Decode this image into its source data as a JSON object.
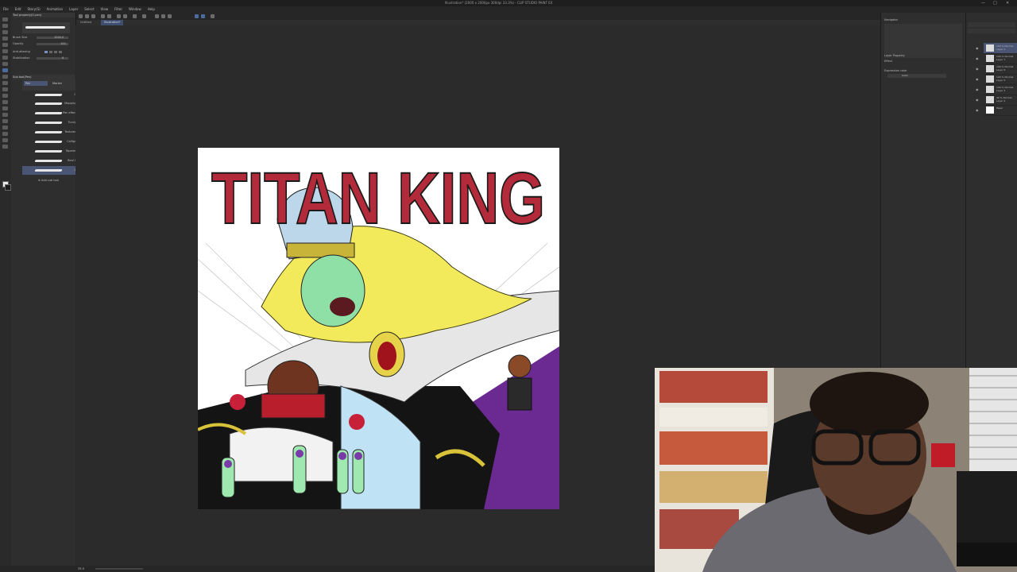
{
  "window": {
    "title": "Illustration* (2000 x 2000px 300dpi 33.3%) - CLIP STUDIO PAINT EX",
    "minimize": "—",
    "maximize": "□",
    "close": "✕"
  },
  "menu": [
    "File",
    "Edit",
    "Story(S)",
    "Animation",
    "Layer",
    "Select",
    "View",
    "Filter",
    "Window",
    "Help"
  ],
  "tabs": [
    "Untitled",
    "Illustration*"
  ],
  "sub_tool": {
    "header": "Tool property(G-pen)",
    "brush_size_label": "Brush Size",
    "brush_size_value": "1000.0",
    "opacity_label": "Opacity",
    "opacity_value": "100",
    "antialias_label": "Anti-aliasing",
    "stabilization_label": "Stabilization",
    "stabilization_value": "6",
    "group_tabs": [
      "Pen",
      "Marker"
    ],
    "group_header": "Sub tool(Pen)",
    "add_tool_label": "Add sub tool"
  },
  "brushes": [
    {
      "name": "G-pen"
    },
    {
      "name": "Mapping pen"
    },
    {
      "name": "Pen effect line"
    },
    {
      "name": "Turnip pen"
    },
    {
      "name": "Textured pen"
    },
    {
      "name": "Calligraphy"
    },
    {
      "name": "Tapered Pen"
    },
    {
      "name": "Real G Pen"
    },
    {
      "name": "G pen"
    }
  ],
  "right_panel": {
    "navigator_header": "Navigator",
    "layer_property_header": "Layer Property",
    "effect_label": "Effect",
    "expression_color_label": "Expression color",
    "expression_color_value": "Color"
  },
  "layers": [
    {
      "name": "100 % Normal Layer 1"
    },
    {
      "name": "100 % Normal Layer 7"
    },
    {
      "name": "100 % Normal Layer 6"
    },
    {
      "name": "100 % Normal Layer 5"
    },
    {
      "name": "100 % Normal Layer 3"
    },
    {
      "name": "40 % Normal Layer 2"
    },
    {
      "name": "Paper"
    }
  ],
  "status": {
    "zoom": "33.3"
  },
  "artwork": {
    "title_text": "TITAN KING",
    "title_color": "#b32a3a"
  },
  "colors": {
    "selection_highlight": "#4a5573",
    "panel_bg": "#2e2e2e",
    "canvas_bg": "#2b2b2b"
  }
}
